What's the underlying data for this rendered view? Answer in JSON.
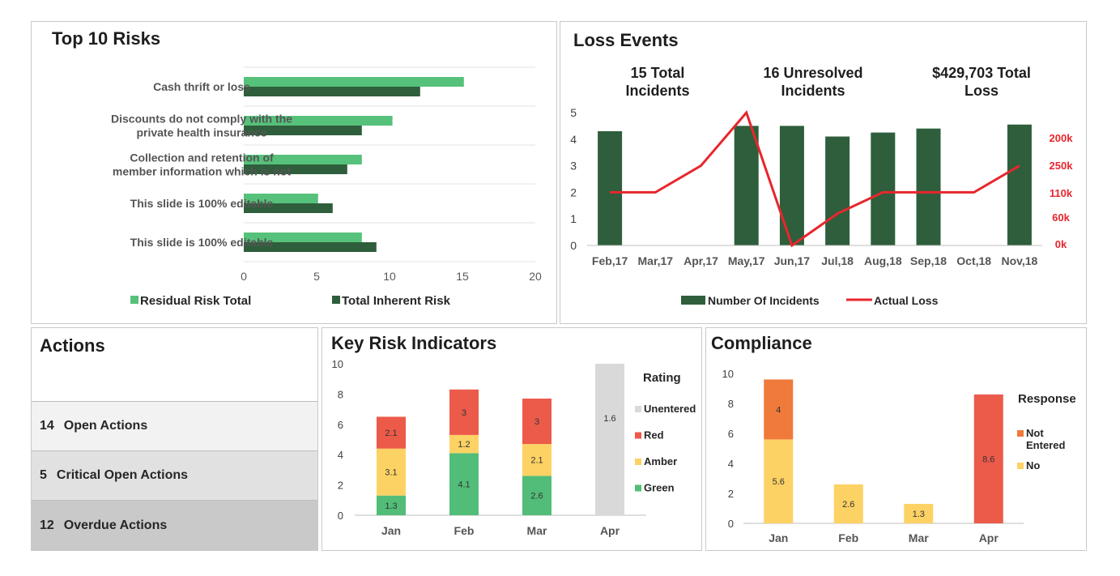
{
  "top_risks": {
    "title": "Top 10 Risks",
    "legend": [
      {
        "label": "Residual Risk Total",
        "color": "#56c17a"
      },
      {
        "label": "Total Inherent Risk",
        "color": "#2e5e3b"
      }
    ]
  },
  "loss_events": {
    "title": "Loss Events",
    "stats": [
      {
        "line1": "15 Total",
        "line2": "Incidents"
      },
      {
        "line1": "16 Unresolved",
        "line2": "Incidents"
      },
      {
        "line1": "$429,703 Total",
        "line2": "Loss"
      }
    ],
    "legend": [
      {
        "label": "Number Of Incidents",
        "color": "#2e5e3b"
      },
      {
        "label": "Actual Loss",
        "color": "#e8262d"
      }
    ]
  },
  "actions": {
    "title": "Actions",
    "rows": [
      {
        "count": "14",
        "label": "Open Actions",
        "bg": "#f2f2f2"
      },
      {
        "count": "5",
        "label": "Critical Open Actions",
        "bg": "#e1e1e1"
      },
      {
        "count": "12",
        "label": "Overdue Actions",
        "bg": "#c9c9c9"
      }
    ]
  },
  "kri": {
    "title": "Key Risk Indicators",
    "legend_title": "Rating",
    "legend": [
      {
        "label": "Unentered",
        "color": "#d9d9d9"
      },
      {
        "label": "Red",
        "color": "#ec5a4a"
      },
      {
        "label": "Amber",
        "color": "#fdd264"
      },
      {
        "label": "Green",
        "color": "#52bd78"
      }
    ]
  },
  "compliance": {
    "title": "Compliance",
    "legend_title": "Response",
    "legend": [
      {
        "label": "Not Entered",
        "color": "#ef7a3c"
      },
      {
        "label": "No",
        "color": "#fdd264"
      }
    ]
  },
  "chart_data": [
    {
      "id": "top_risks",
      "type": "bar",
      "orientation": "horizontal",
      "title": "Top 10 Risks",
      "categories": [
        "Cash thrift or loss",
        "Discounts do not comply with the private health insurance",
        "Collection and retention of member information which is not",
        "This slide is 100% editable",
        "This slide is 100% editable"
      ],
      "series": [
        {
          "name": "Residual Risk Total",
          "values": [
            15.1,
            10.2,
            8.1,
            5.1,
            8.1
          ],
          "color": "#56c17a"
        },
        {
          "name": "Total Inherent Risk",
          "values": [
            12.1,
            8.1,
            7.1,
            6.1,
            9.1
          ],
          "color": "#2e5e3b"
        }
      ],
      "xlim": [
        0,
        20
      ],
      "xticks": [
        0,
        5,
        10,
        15,
        20
      ],
      "grid": true,
      "legend": "bottom"
    },
    {
      "id": "loss_events",
      "type": "bar",
      "title": "Loss Events",
      "categories": [
        "Feb,17",
        "Mar,17",
        "Apr,17",
        "May,17",
        "Jun,17",
        "Jul,18",
        "Aug,18",
        "Sep,18",
        "Oct,18",
        "Nov,18"
      ],
      "series": [
        {
          "name": "Number Of Incidents",
          "type": "bar",
          "axis": "left",
          "values": [
            4.3,
            0,
            0,
            4.5,
            4.5,
            4.1,
            4.25,
            4.4,
            0,
            4.55
          ],
          "color": "#2e5e3b"
        },
        {
          "name": "Actual Loss",
          "type": "line",
          "axis": "right",
          "values": [
            2,
            2,
            3,
            5,
            0,
            1.2,
            2,
            2,
            2,
            3
          ],
          "color": "#e8262d"
        }
      ],
      "ylim": [
        0,
        5
      ],
      "yticks": [
        0,
        1,
        2,
        3,
        4,
        5
      ],
      "y2_tick_labels": [
        "0k",
        "60k",
        "110k",
        "250k",
        "200k"
      ],
      "grid": false,
      "legend": "bottom"
    },
    {
      "id": "kri",
      "type": "bar",
      "stacked": true,
      "title": "Key Risk Indicators",
      "categories": [
        "Jan",
        "Feb",
        "Mar",
        "Apr"
      ],
      "series": [
        {
          "name": "Green",
          "values": [
            1.3,
            4.1,
            2.6,
            0
          ],
          "color": "#52bd78"
        },
        {
          "name": "Amber",
          "values": [
            3.1,
            1.2,
            2.1,
            0
          ],
          "color": "#fdd264"
        },
        {
          "name": "Red",
          "values": [
            2.1,
            3,
            3,
            0
          ],
          "color": "#ec5a4a"
        },
        {
          "name": "Unentered",
          "values": [
            0,
            0,
            0,
            10
          ],
          "color": "#d9d9d9"
        }
      ],
      "data_labels": [
        {
          "category": "Jan",
          "series": "Green",
          "text": "1.3"
        },
        {
          "category": "Jan",
          "series": "Amber",
          "text": "3.1"
        },
        {
          "category": "Jan",
          "series": "Red",
          "text": "2.1"
        },
        {
          "category": "Feb",
          "series": "Green",
          "text": "4.1"
        },
        {
          "category": "Feb",
          "series": "Amber",
          "text": "1.2"
        },
        {
          "category": "Feb",
          "series": "Red",
          "text": "3"
        },
        {
          "category": "Mar",
          "series": "Green",
          "text": "2.6"
        },
        {
          "category": "Mar",
          "series": "Amber",
          "text": "2.1"
        },
        {
          "category": "Mar",
          "series": "Red",
          "text": "3"
        },
        {
          "category": "Apr",
          "series": "Unentered",
          "text": "1.6"
        }
      ],
      "ylim": [
        0,
        10
      ],
      "yticks": [
        0,
        2,
        4,
        6,
        8,
        10
      ],
      "grid": false,
      "legend": "right"
    },
    {
      "id": "compliance",
      "type": "bar",
      "stacked": true,
      "title": "Compliance",
      "categories": [
        "Jan",
        "Feb",
        "Mar",
        "Apr"
      ],
      "series": [
        {
          "name": "No",
          "values": [
            5.6,
            2.6,
            1.3,
            0
          ],
          "color": "#fdd264"
        },
        {
          "name": "Not Entered",
          "values": [
            4,
            0,
            0,
            0
          ],
          "color": "#ef7a3c"
        },
        {
          "name": "",
          "values": [
            0,
            0,
            0,
            8.6
          ],
          "color": "#ec5a4a"
        }
      ],
      "data_labels": [
        {
          "category": "Jan",
          "series": "No",
          "text": "5.6"
        },
        {
          "category": "Jan",
          "series": "Not Entered",
          "text": "4"
        },
        {
          "category": "Feb",
          "series": "No",
          "text": "2.6"
        },
        {
          "category": "Mar",
          "series": "No",
          "text": "1.3"
        },
        {
          "category": "Apr",
          "series": "",
          "text": "8.6"
        }
      ],
      "ylim": [
        0,
        10
      ],
      "yticks": [
        0,
        2,
        4,
        6,
        8,
        10
      ],
      "grid": false,
      "legend": "right"
    }
  ]
}
